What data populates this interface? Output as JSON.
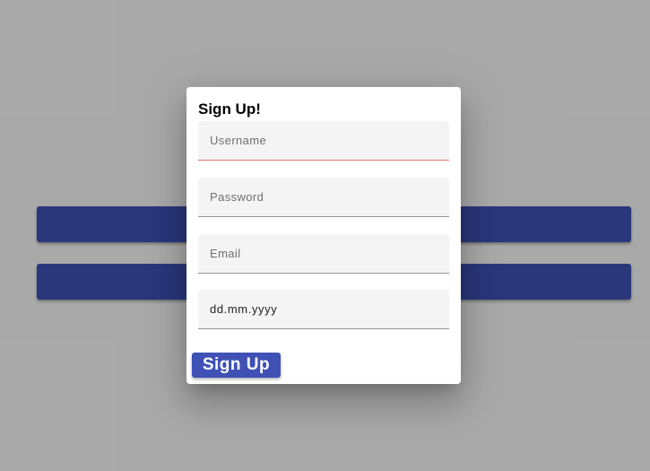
{
  "dialog": {
    "title": "Sign Up!",
    "fields": {
      "username_placeholder": "Username",
      "password_placeholder": "Password",
      "email_placeholder": "Email",
      "date_placeholder": "dd.mm.yyyy"
    },
    "submit_label": "Sign Up"
  },
  "colors": {
    "primary": "#3f51b5",
    "overlay": "rgba(0,0,0,0.32)",
    "invalid_underline": "#e57373"
  }
}
